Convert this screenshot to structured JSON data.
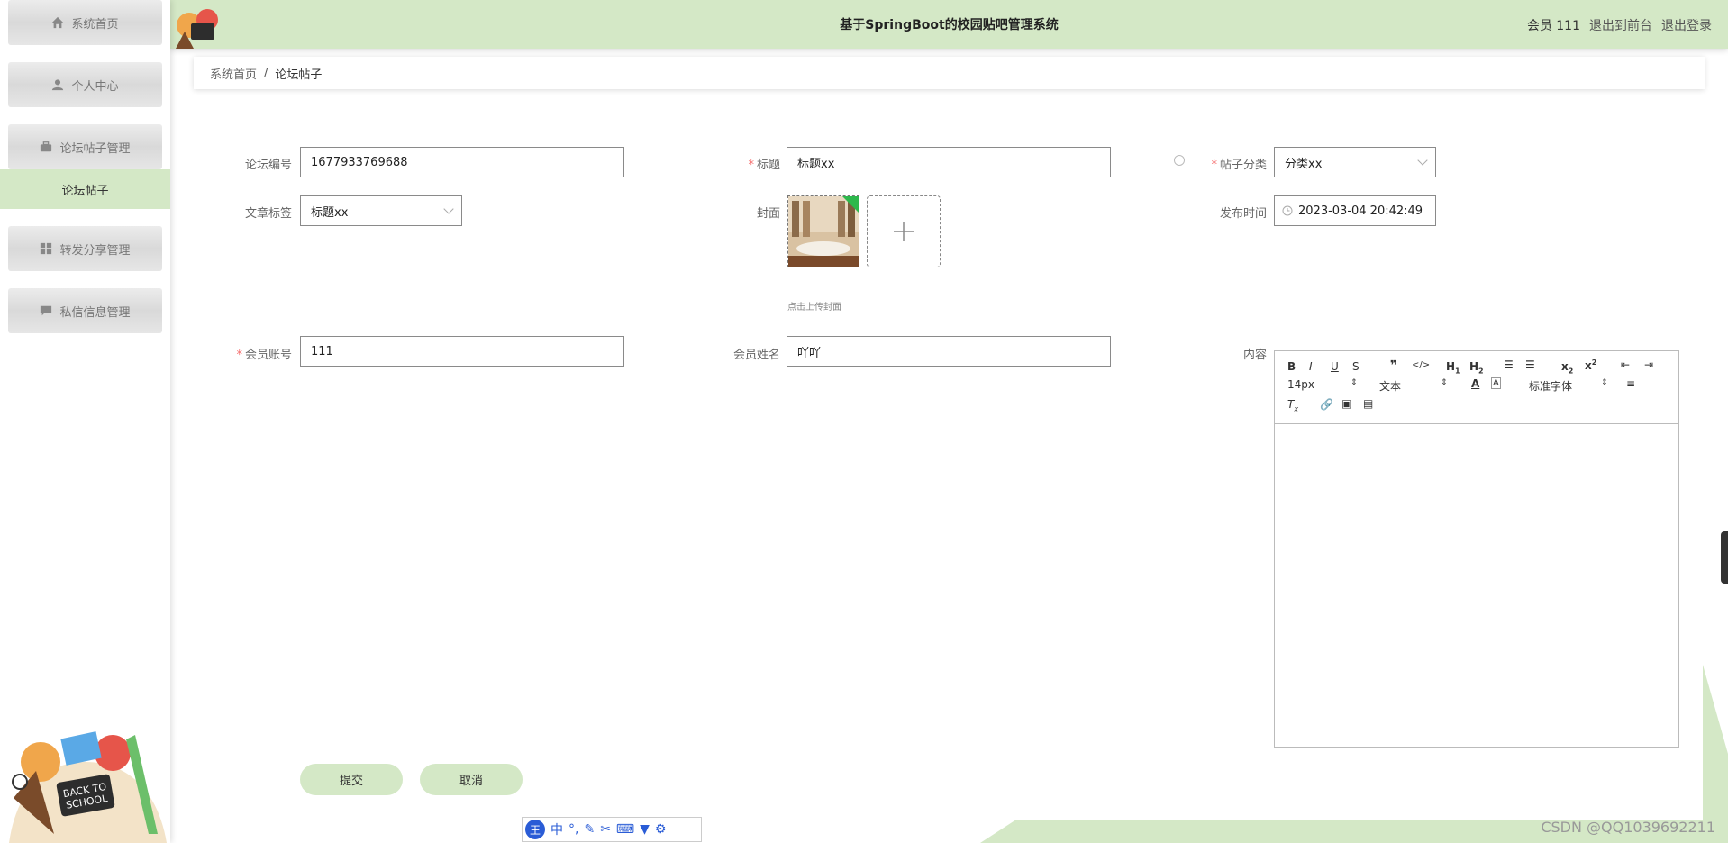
{
  "sidebar": {
    "items": [
      {
        "label": "系统首页",
        "icon": "home-icon"
      },
      {
        "label": "个人中心",
        "icon": "user-icon"
      },
      {
        "label": "论坛帖子管理",
        "icon": "briefcase-icon"
      },
      {
        "label": "转发分享管理",
        "icon": "grid-icon"
      },
      {
        "label": "私信信息管理",
        "icon": "chat-icon"
      }
    ],
    "active_subitem": "论坛帖子"
  },
  "header": {
    "title": "基于SpringBoot的校园贴吧管理系统",
    "user": "会员 111",
    "links": [
      "退出到前台",
      "退出登录"
    ]
  },
  "breadcrumb": {
    "home": "系统首页",
    "separator": "/",
    "current": "论坛帖子"
  },
  "form": {
    "forum_no": {
      "label": "论坛编号",
      "value": "1677933769688"
    },
    "title": {
      "label": "标题",
      "value": "标题xx"
    },
    "category": {
      "label": "帖子分类",
      "value": "分类xx"
    },
    "tag": {
      "label": "文章标签",
      "value": "标题xx"
    },
    "cover": {
      "label": "封面",
      "hint": "点击上传封面"
    },
    "publish_time": {
      "label": "发布时间",
      "value": "2023-03-04 20:42:49"
    },
    "member_account": {
      "label": "会员账号",
      "value": "111"
    },
    "member_name": {
      "label": "会员姓名",
      "value": "吖吖"
    },
    "content": {
      "label": "内容"
    }
  },
  "editor": {
    "font_size": "14px",
    "text_type": "文本",
    "font_family": "标准字体"
  },
  "buttons": {
    "submit": "提交",
    "cancel": "取消"
  },
  "ime": {
    "label": "中"
  },
  "watermark": "CSDN @QQ1039692211",
  "colors": {
    "accent": "#d4e8c6",
    "required": "#f56c6c"
  }
}
